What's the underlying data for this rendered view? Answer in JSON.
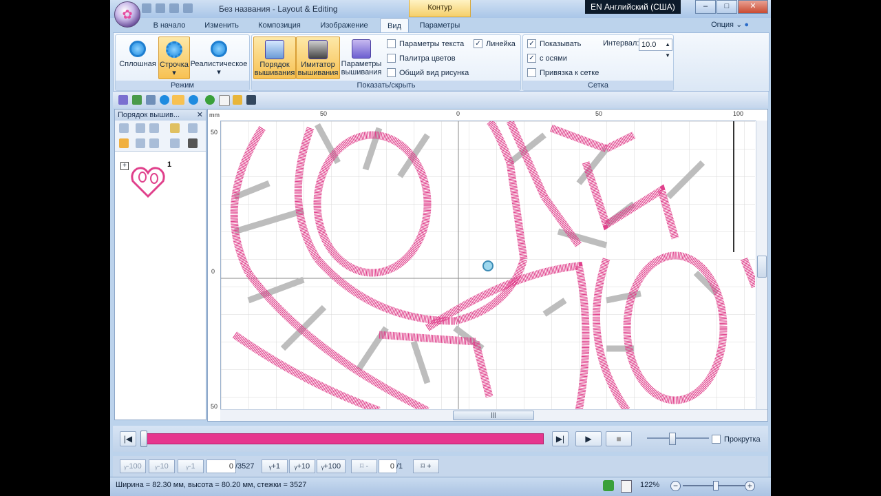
{
  "window": {
    "title": "Без названия - Layout & Editing",
    "context_tab": "Контур",
    "language_indicator": "EN Английский (США)",
    "buttons": {
      "minimize": "–",
      "maximize": "□",
      "close": "✕"
    }
  },
  "ribbon_tabs": [
    {
      "label": "В начало"
    },
    {
      "label": "Изменить"
    },
    {
      "label": "Композиция"
    },
    {
      "label": "Изображение"
    },
    {
      "label": "Вид"
    },
    {
      "label": "Параметры"
    }
  ],
  "active_tab": "Вид",
  "options_menu": "Опция",
  "groups": {
    "mode": {
      "label": "Режим",
      "buttons": [
        {
          "label": "Сплошная",
          "selected": false
        },
        {
          "label": "Строчка",
          "selected": true
        },
        {
          "label": "Реалистическое",
          "selected": false
        }
      ]
    },
    "show_hide": {
      "label": "Показать/скрыть",
      "buttons": [
        {
          "line1": "Порядок",
          "line2": "вышивания",
          "selected": true
        },
        {
          "line1": "Имитатор",
          "line2": "вышивания",
          "selected": true
        },
        {
          "line1": "Параметры",
          "line2": "вышивания",
          "selected": false
        }
      ],
      "checks": [
        {
          "label": "Параметры текста",
          "checked": false
        },
        {
          "label": "Палитра цветов",
          "checked": false
        },
        {
          "label": "Общий вид рисунка",
          "checked": false
        },
        {
          "label": "Линейка",
          "checked": true
        }
      ]
    },
    "grid": {
      "label": "Сетка",
      "checks": [
        {
          "label": "Показывать",
          "checked": true
        },
        {
          "label": "с осями",
          "checked": true
        },
        {
          "label": "Привязка к сетке",
          "checked": false
        }
      ],
      "interval_label": "Интервал:",
      "interval_value": "10.0"
    }
  },
  "left_pane": {
    "title": "Порядок вышив...",
    "pin": "ᵖ",
    "close": "✕",
    "tree_expander": "+",
    "item_number": "1"
  },
  "rulers": {
    "unit": "mm",
    "h_labels": [
      "50",
      "0",
      "50",
      "100"
    ],
    "v_labels": [
      "50",
      "0",
      "50"
    ]
  },
  "player": {
    "first": "|◀",
    "last": "▶|",
    "play": "▶",
    "stop": "■",
    "scroll_label": "Прокрутка",
    "progress_fraction": 1.0
  },
  "stitch_nav": {
    "minus100": "-100",
    "minus10": "-10",
    "minus1": "-1",
    "current": "0",
    "total": "/3527",
    "plus1": "+1",
    "plus10": "+10",
    "plus100": "+100",
    "obj_minus": "-",
    "obj_current": "0",
    "obj_total": "/1",
    "obj_plus": "+",
    "icon_glyph": "ᵧ"
  },
  "status": {
    "dimensions": "Ширина = 82.30 мм, высота = 80.20 мм, стежки = 3527",
    "zoom": "122%",
    "zoom_out": "−",
    "zoom_in": "+"
  },
  "colors": {
    "stitch": "#e0418c",
    "progress": "#e6358e",
    "grid": "#cfcfcf",
    "ribbon_selected": "#f7c152"
  }
}
